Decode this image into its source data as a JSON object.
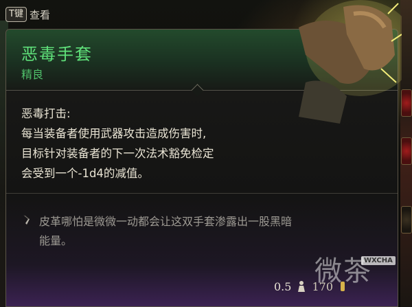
{
  "key_hint": {
    "key": "T键",
    "label": "查看"
  },
  "item": {
    "name": "恶毒手套",
    "rarity": "精良",
    "effect_title": "恶毒打击:",
    "effect_lines": [
      "每当装备者使用武器攻击造成伤害时,",
      "目标针对装备者的下一次法术豁免检定",
      "会受到一个-1d4的减值。"
    ],
    "lore_lines": [
      "皮革哪怕是微微一动都会让这双手套渗露出一股黑暗",
      "能量。"
    ],
    "weight": "0.5",
    "price": "170"
  },
  "watermark": {
    "text": "微茶",
    "badge": "WXCHA"
  },
  "colors": {
    "item_name": "#5fe07a",
    "rarity": "#4fbf6a",
    "body_text": "#e9e4d4",
    "lore_text": "#9d9a93"
  },
  "icons": {
    "lore": "feather-quill-icon",
    "weight": "weight-icon",
    "gold": "gold-coin-icon"
  }
}
